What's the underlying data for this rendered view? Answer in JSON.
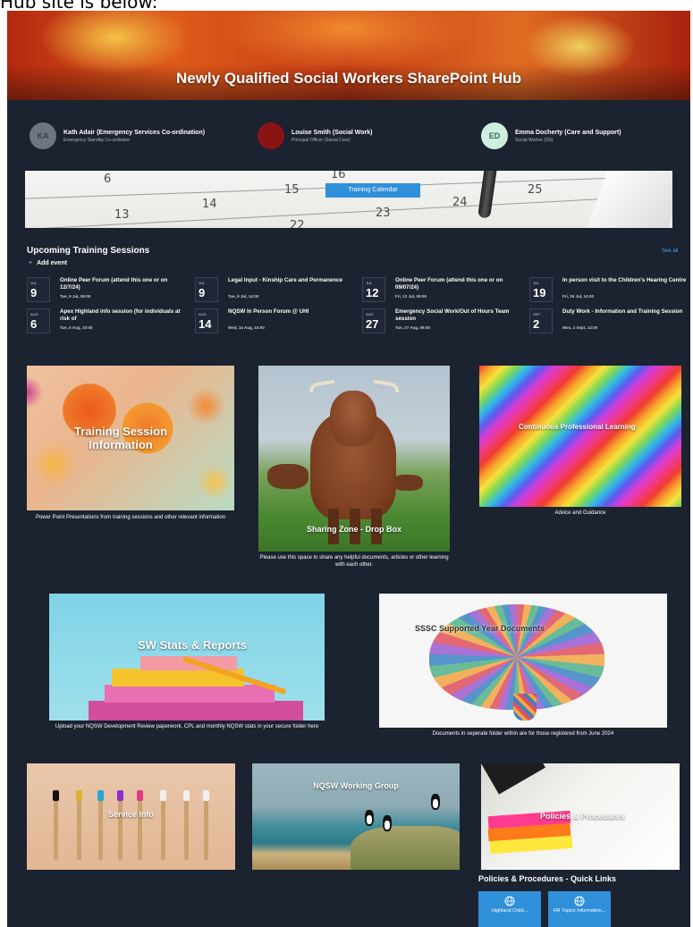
{
  "caption": "Hub site is below:",
  "banner": {
    "title": "Newly Qualified Social Workers SharePoint Hub"
  },
  "people": [
    {
      "initials": "KA",
      "name": "Kath Adair (Emergency Services Co-ordination)",
      "role": "Emergency Standby Co-ordinator",
      "avatar_color": "#6e7781",
      "initials_color": "#3a3f46"
    },
    {
      "initials": "",
      "name": "Louise Smith (Social Work)",
      "role": "Principal Officer (Social Care)",
      "avatar_color": "#8a1414",
      "initials_color": "#8a1414"
    },
    {
      "initials": "ED",
      "name": "Emma Docherty (Care and Support)",
      "role": "Social Worker (SS)",
      "avatar_color": "#cfeee0",
      "initials_color": "#2d6e55"
    }
  ],
  "calendar": {
    "button_label": "Training Calendar",
    "numbers": [
      "6",
      "16",
      "15",
      "14",
      "13",
      "23",
      "24",
      "25",
      "22"
    ]
  },
  "sessions": {
    "title": "Upcoming Training Sessions",
    "see_all": "See all",
    "add_event": "Add event",
    "events": [
      {
        "month": "Jul",
        "day": "9",
        "title": "Online Peer Forum (attend this one or on 12/7/24)",
        "time": "Tue, 9 Jul, 09:00"
      },
      {
        "month": "Jul",
        "day": "9",
        "title": "Legal Input - Kinship Care and Permanence",
        "time": "Tue, 9 Jul, 14:00"
      },
      {
        "month": "Jul",
        "day": "12",
        "title": "Online Peer Forum (attend this one or on 09/07/24)",
        "time": "Fri, 12 Jul, 09:00"
      },
      {
        "month": "Jul",
        "day": "19",
        "title": "In person visit to the Children's Hearing Centre",
        "time": "Fri, 19 Jul, 14:00"
      },
      {
        "month": "Aug",
        "day": "6",
        "title": "Apex Highland info session (for individuals at risk of",
        "time": "Tue, 6 Aug, 10:00"
      },
      {
        "month": "Aug",
        "day": "14",
        "title": "NQSW In Person Forum @ UHI",
        "time": "Wed, 14 Aug, 10:00"
      },
      {
        "month": "Aug",
        "day": "27",
        "title": "Emergency Social Work/Out of Hours Team session",
        "time": "Tue, 27 Aug, 09:00"
      },
      {
        "month": "Sep",
        "day": "2",
        "title": "Duty Work - Information and Training Session",
        "time": "Mon, 2 Sept, 14:00"
      }
    ]
  },
  "tiles": {
    "training": {
      "label": "Training Session Information",
      "caption": "Power Point Presentations from training sessions and other relevant information"
    },
    "sharing": {
      "label": "Sharing Zone - Drop Box",
      "caption": "Please use this space to share any helpful documents, articles or other learning with each other."
    },
    "cpl": {
      "label": "Continuous Professional Learning",
      "caption": "Advice and Guidance"
    },
    "stats": {
      "label": "SW Stats & Reports",
      "caption": "Upload your NQSW Development Review paperwork, CPL and monthly NQSW stats in your secure folder here"
    },
    "sssc": {
      "label": "SSSC Supported Year Documents",
      "caption": "Documents in seperate folder within are for those registered from June 2024"
    },
    "service": {
      "label": "Service Info"
    },
    "working_group": {
      "label": "NQSW Working Group"
    },
    "policies": {
      "label": "Policies & Procedures"
    }
  },
  "quick_links": {
    "title": "Policies & Procedures - Quick Links",
    "items": [
      {
        "label": "Highland Child...",
        "icon": "globe-icon"
      },
      {
        "label": "HR Topics Information...",
        "icon": "globe-icon"
      }
    ]
  },
  "colors": {
    "page_bg": "#1b2230",
    "accent": "#2f8fd8",
    "link": "#4aa3f0"
  }
}
